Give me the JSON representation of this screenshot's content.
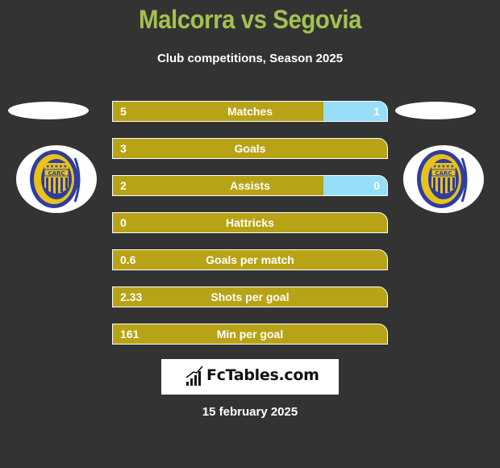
{
  "header": {
    "title": "Malcorra vs Segovia",
    "subtitle": "Club competitions, Season 2025"
  },
  "players": {
    "left": {
      "name": "Malcorra",
      "club_badge": "rosario-central-badge-icon"
    },
    "right": {
      "name": "Segovia",
      "club_badge": "rosario-central-badge-icon"
    }
  },
  "colors": {
    "title": "#a3c150",
    "left_bar": "#b8a317",
    "right_bar": "#97def8",
    "background": "#333333"
  },
  "stats": [
    {
      "label": "Matches",
      "left": "5",
      "right": "1",
      "right_share": 0.2333
    },
    {
      "label": "Goals",
      "left": "3",
      "right": "",
      "right_share": 0
    },
    {
      "label": "Assists",
      "left": "2",
      "right": "0",
      "right_share": 0.2333
    },
    {
      "label": "Hattricks",
      "left": "0",
      "right": "",
      "right_share": 0
    },
    {
      "label": "Goals per match",
      "left": "0.6",
      "right": "",
      "right_share": 0
    },
    {
      "label": "Shots per goal",
      "left": "2.33",
      "right": "",
      "right_share": 0
    },
    {
      "label": "Min per goal",
      "left": "161",
      "right": "",
      "right_share": 0
    }
  ],
  "footer": {
    "brand": "FcTables.com",
    "date": "15 february 2025"
  }
}
